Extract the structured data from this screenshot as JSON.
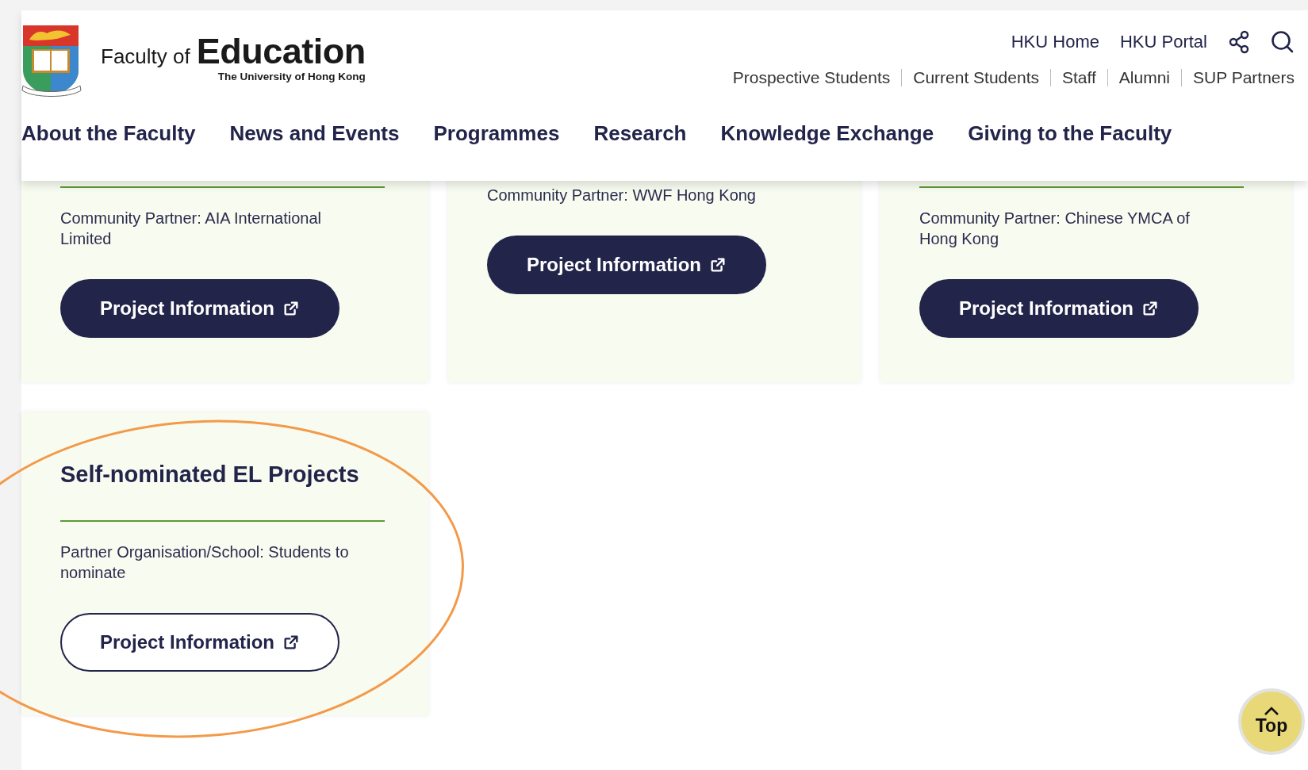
{
  "header": {
    "brand": {
      "prefix": "Faculty of",
      "name": "Education",
      "subtitle": "The University of Hong Kong"
    },
    "utility_links": [
      "HKU Home",
      "HKU Portal"
    ],
    "audience_links": [
      "Prospective Students",
      "Current Students",
      "Staff",
      "Alumni",
      "SUP Partners"
    ],
    "nav": [
      "About the Faculty",
      "News and Events",
      "Programmes",
      "Research",
      "Knowledge Exchange",
      "Giving to the Faculty"
    ]
  },
  "cards": [
    {
      "divider": true,
      "text": "Community Partner: AIA International Limited",
      "button": {
        "label": "Project Information",
        "kind": "filled"
      }
    },
    {
      "divider": false,
      "text": "Community Partner: WWF Hong Kong",
      "button": {
        "label": "Project Information",
        "kind": "filled"
      }
    },
    {
      "divider": true,
      "text": "Community Partner: Chinese YMCA of Hong Kong",
      "button": {
        "label": "Project Information",
        "kind": "filled"
      }
    },
    {
      "title": "Self-nominated EL Projects",
      "divider": true,
      "text": "Partner Organisation/School: Students to nominate",
      "button": {
        "label": "Project Information",
        "kind": "outline"
      }
    }
  ],
  "top_button": {
    "label": "Top"
  }
}
